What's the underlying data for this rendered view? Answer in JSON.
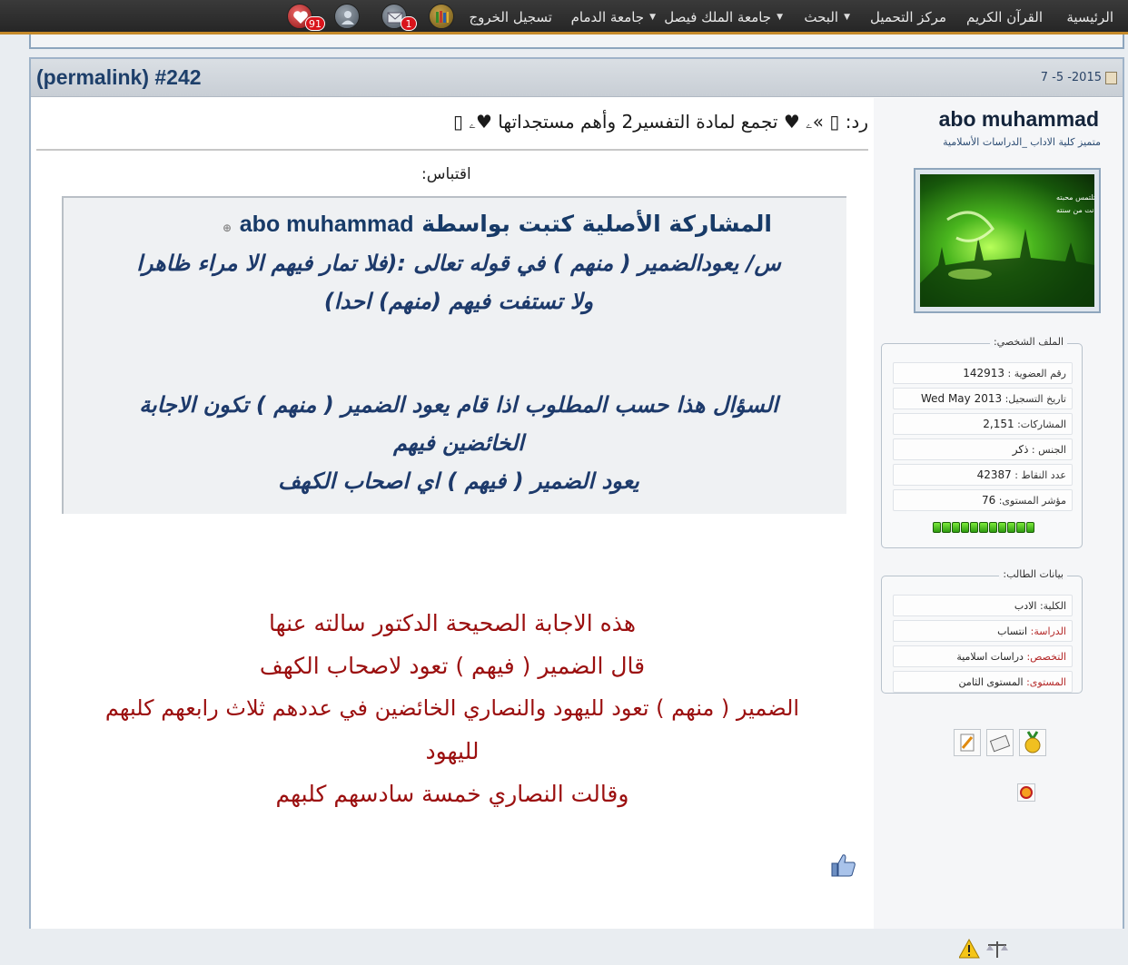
{
  "nav": {
    "home": "الرئيسية",
    "quran": "القرآن الكريم",
    "upload_center": "مركز التحميل",
    "search": "البحث",
    "kfu": "جامعة الملك فيصل",
    "dammam": "جامعة الدمام",
    "logout": "تسجيل الخروج",
    "messages_count": "1",
    "notifications_count": "91"
  },
  "post": {
    "permalink": "(permalink) #242",
    "date": "7 -5 -2015",
    "title_prefix": "رد:",
    "title_text": "»ۦ ♥ تجمع لمادة التفسير2 وأهم مستجداتها ♥ۦ",
    "quote_label": "اقتباس:",
    "quote_author_prefix": "المشاركة الأصلية كتبت بواسطة",
    "quote_author": "abo muhammad",
    "quote_lines": [
      "س/ يعودالضمير ( منهم ) في قوله تعالى :(فلا تمار فيهم الا مراء ظاهرا",
      "ولا تستفت فيهم (منهم) احدا)",
      "السؤال هذا حسب المطلوب اذا قام يعود الضمير ( منهم ) تكون الاجابة",
      "الخائضين فيهم",
      "يعود الضمير ( فيهم ) اي اصحاب الكهف"
    ],
    "answer_lines": [
      "هذه الاجابة الصحيحة الدكتور سالته عنها",
      "قال الضمير ( فيهم ) تعود لاصحاب الكهف",
      "الضمير ( منهم ) تعود لليهود والنصاري الخائضين في عددهم ثلاث رابعهم كلبهم",
      "لليهود",
      "وقالت النصاري خمسة سادسهم كلبهم"
    ]
  },
  "user": {
    "name": "abo muhammad",
    "title": "متميز كلية الاداب _الدراسات الأسلامية",
    "profile_legend": "الملف الشخصي:",
    "profile_rows": [
      {
        "label": "رقم العضوية : ",
        "value": "142913"
      },
      {
        "label": "تاريخ التسجيل: ",
        "value": "Wed May 2013"
      },
      {
        "label": "المشاركات: ",
        "value": "2,151"
      },
      {
        "label": "الجنس : ",
        "value": "ذكر"
      },
      {
        "label": "عدد النقاط : ",
        "value": "42387"
      },
      {
        "label": "مؤشر المستوى: ",
        "value": "76"
      }
    ],
    "student_legend": "بيانات الطالب:",
    "student_rows": [
      {
        "label": "الكلية: ",
        "value": "الادب"
      },
      {
        "label": "الدراسة: ",
        "value": "انتساب"
      },
      {
        "label": "التخصص: ",
        "value": "دراسات اسلامية"
      },
      {
        "label": "المستوى: ",
        "value": "المستوى الثامن"
      }
    ]
  },
  "icons": {
    "notifications": "heart-icon",
    "profile": "user-icon",
    "messages": "envelope-icon",
    "library": "books-icon",
    "like": "thumbs-up-icon",
    "report": "warning-icon",
    "scales": "scales-icon"
  }
}
